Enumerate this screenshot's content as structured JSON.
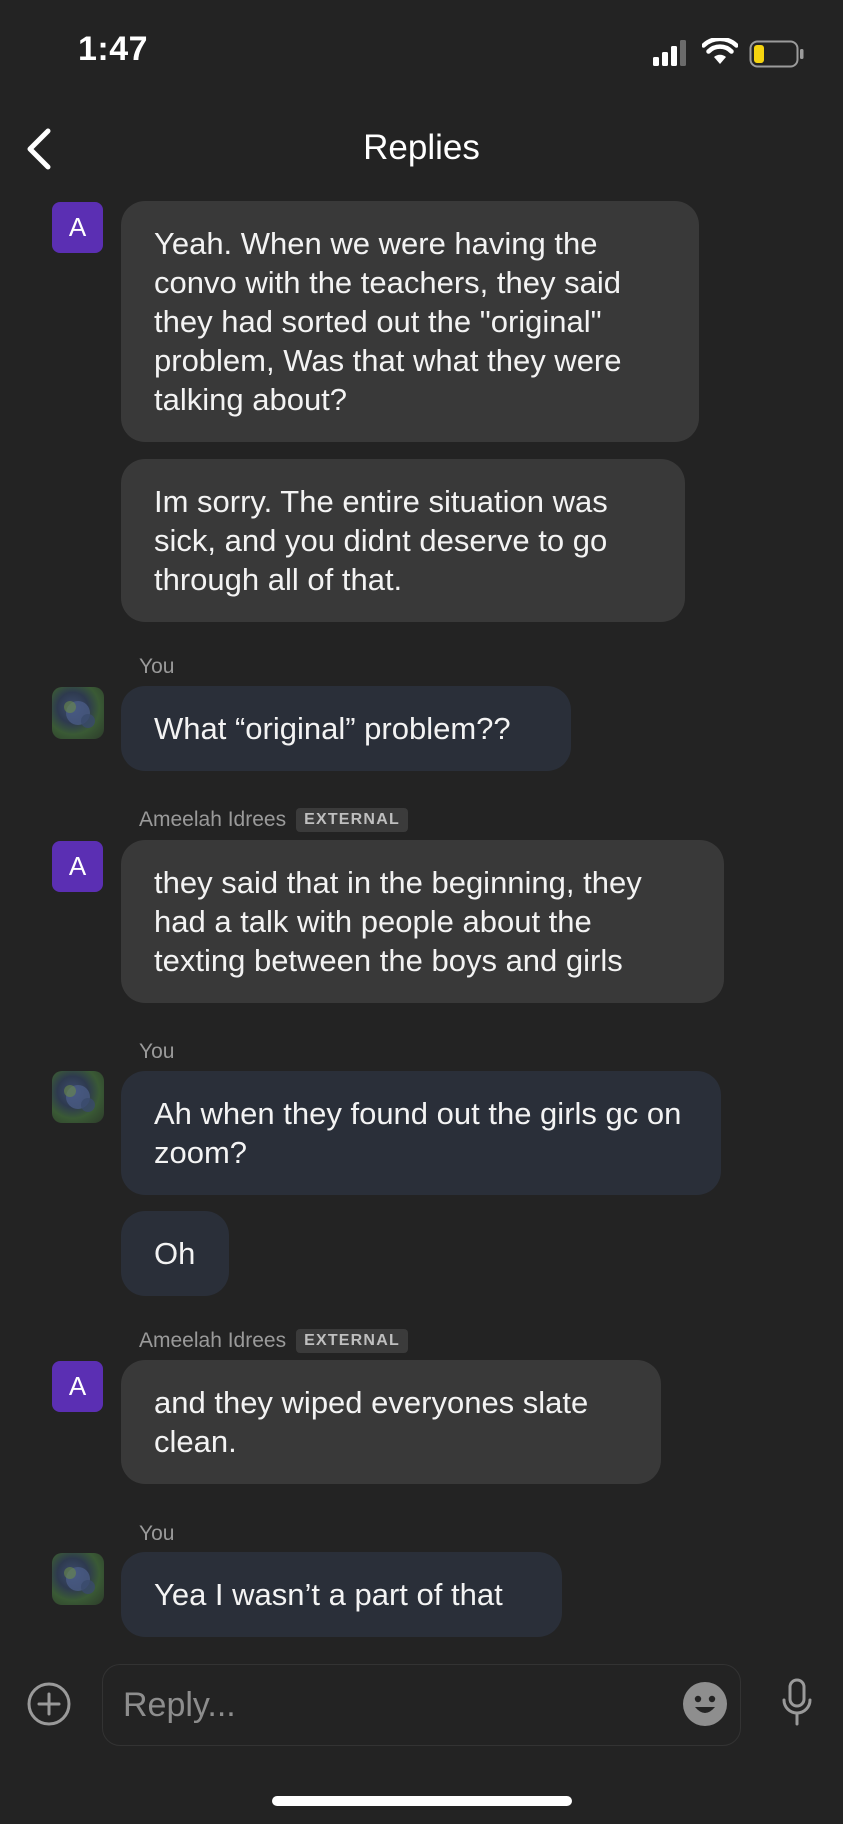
{
  "status_bar": {
    "time": "1:47"
  },
  "header": {
    "title": "Replies"
  },
  "messages": [
    {
      "avatar": "A",
      "text": "Yeah. When we were having the convo with the teachers, they said they had sorted out the \"original\" problem, Was that what they were talking about?"
    },
    {
      "text": "Im sorry. The entire situation was sick, and you didnt deserve to go through all of that."
    },
    {
      "sender": "You",
      "text": "What “original” problem??"
    },
    {
      "sender": "Ameelah Idrees",
      "badge": "EXTERNAL",
      "avatar": "A",
      "text": "they said that in the beginning, they had a talk with people about the texting between the boys and girls"
    },
    {
      "sender": "You",
      "text": "Ah when they found out the girls gc on zoom?"
    },
    {
      "text": "Oh"
    },
    {
      "sender": "Ameelah Idrees",
      "badge": "EXTERNAL",
      "avatar": "A",
      "text": "and they wiped everyones slate clean."
    },
    {
      "sender": "You",
      "text": "Yea I wasn’t a part of that"
    }
  ],
  "composer": {
    "placeholder": "Reply..."
  },
  "colors": {
    "background": "#232323",
    "incoming_bubble": "#393939",
    "outgoing_bubble": "#2a2f39",
    "avatar_accent": "#5b2fb3",
    "battery_low": "#f5d40f"
  },
  "icons": [
    "signal-icon",
    "wifi-icon",
    "battery-icon",
    "back-chevron-icon",
    "add-circle-icon",
    "emoji-icon",
    "microphone-icon",
    "photo-avatar"
  ]
}
